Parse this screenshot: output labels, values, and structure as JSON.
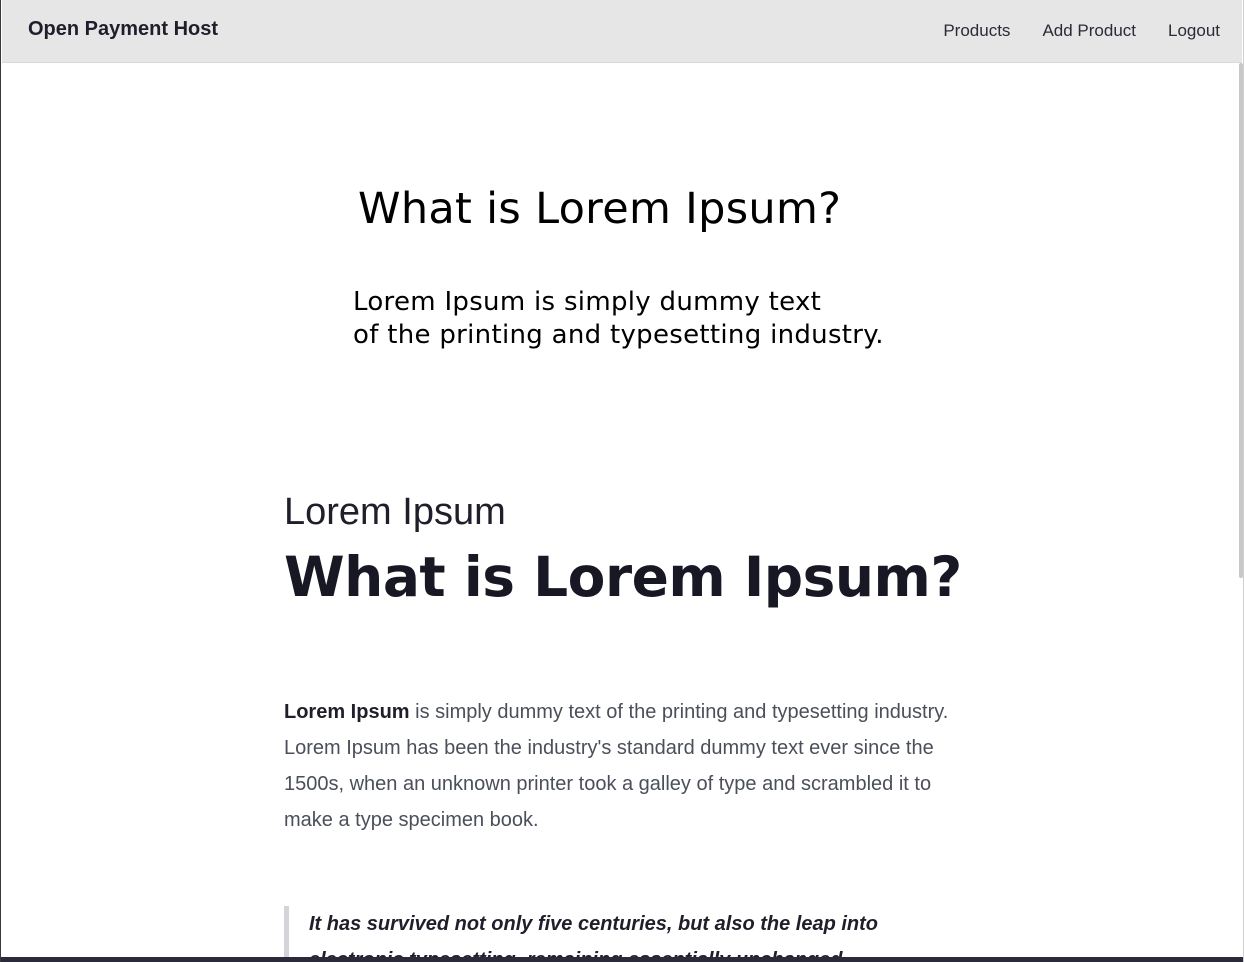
{
  "navbar": {
    "brand": "Open Payment Host",
    "links": [
      "Products",
      "Add Product",
      "Logout"
    ]
  },
  "hero": {
    "title": "What is Lorem Ipsum?",
    "subtitle_line1": "Lorem Ipsum is simply dummy text",
    "subtitle_line2": "of the printing and typesetting industry."
  },
  "article": {
    "eyebrow": "Lorem Ipsum",
    "headline": "What is Lorem Ipsum?",
    "lead_bold": "Lorem Ipsum",
    "lead_rest": " is simply dummy text of the printing and typesetting industry. Lorem Ipsum has been the industry's standard dummy text ever since the 1500s, when an unknown printer took a galley of type and scrambled it to make a type specimen book.",
    "quote": "It has survived not only five centuries, but also the leap into electronic typesetting, remaining essentially unchanged."
  }
}
